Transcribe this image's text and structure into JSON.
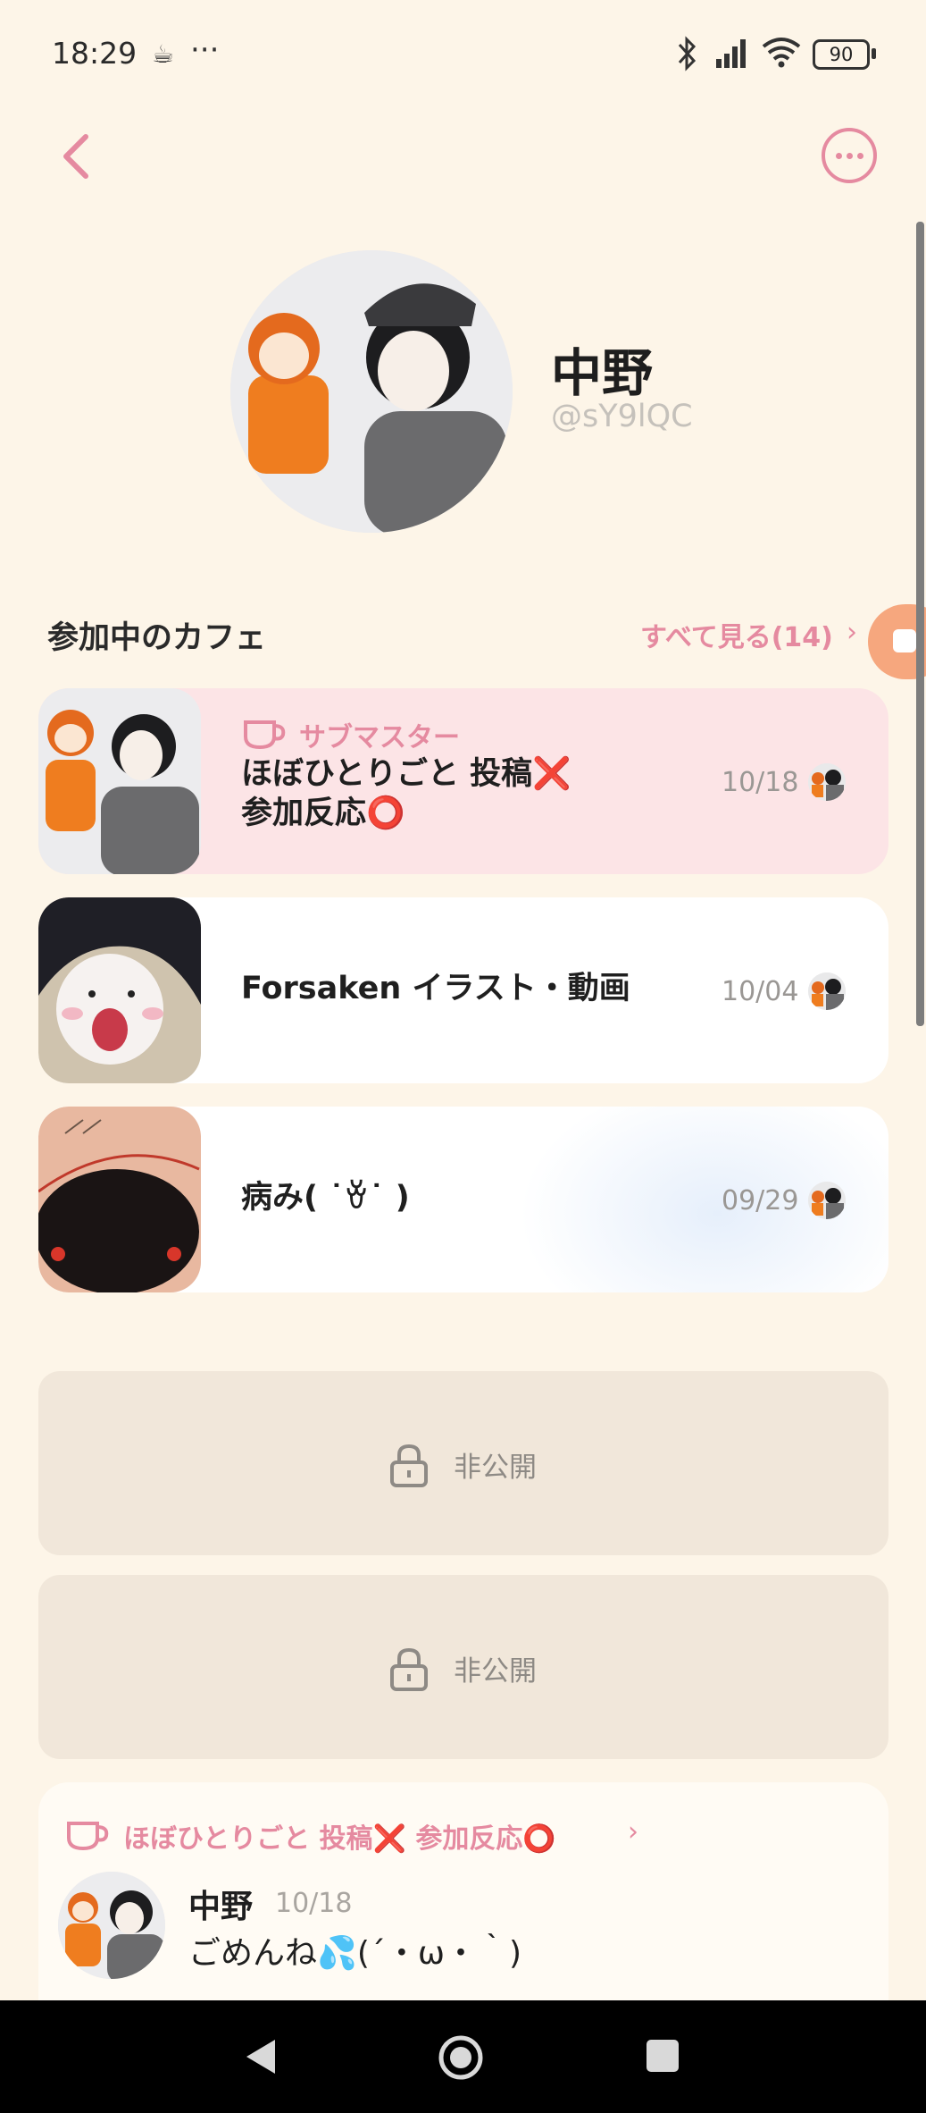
{
  "status_bar": {
    "time": "18:29",
    "dots": "···",
    "battery": "90"
  },
  "profile": {
    "name": "中野",
    "handle": "@sY9lQC"
  },
  "cafes_section": {
    "title": "参加中のカフェ",
    "see_all": "すべて見る(14)",
    "items": [
      {
        "role": "サブマスター",
        "title_line1": "ほぼひとりごと 投稿❌",
        "title_line2": "参加反応⭕",
        "date": "10/18"
      },
      {
        "title": "Forsaken イラスト・動画",
        "date": "10/04"
      },
      {
        "title": "病み(   ˙ꈊ˙ )",
        "date": "09/29"
      }
    ]
  },
  "private_cards": [
    {
      "label": "非公開"
    },
    {
      "label": "非公開"
    }
  ],
  "recent_post": {
    "cafe_name": "ほぼひとりごと 投稿❌ 参加反応⭕",
    "author": "中野",
    "date": "10/18",
    "text": "ごめんね💦(´・ω・｀)"
  },
  "colors": {
    "background": "#fdf5e8",
    "accent_pink": "#e58aa0",
    "card_pink": "#fce4e6",
    "private_bg": "#f1e7da",
    "orange_tab": "#f6a77e"
  },
  "icons": {
    "back": "chevron-left-icon",
    "more": "more-horizontal-icon",
    "cup": "cup-icon",
    "lock": "lock-icon"
  }
}
